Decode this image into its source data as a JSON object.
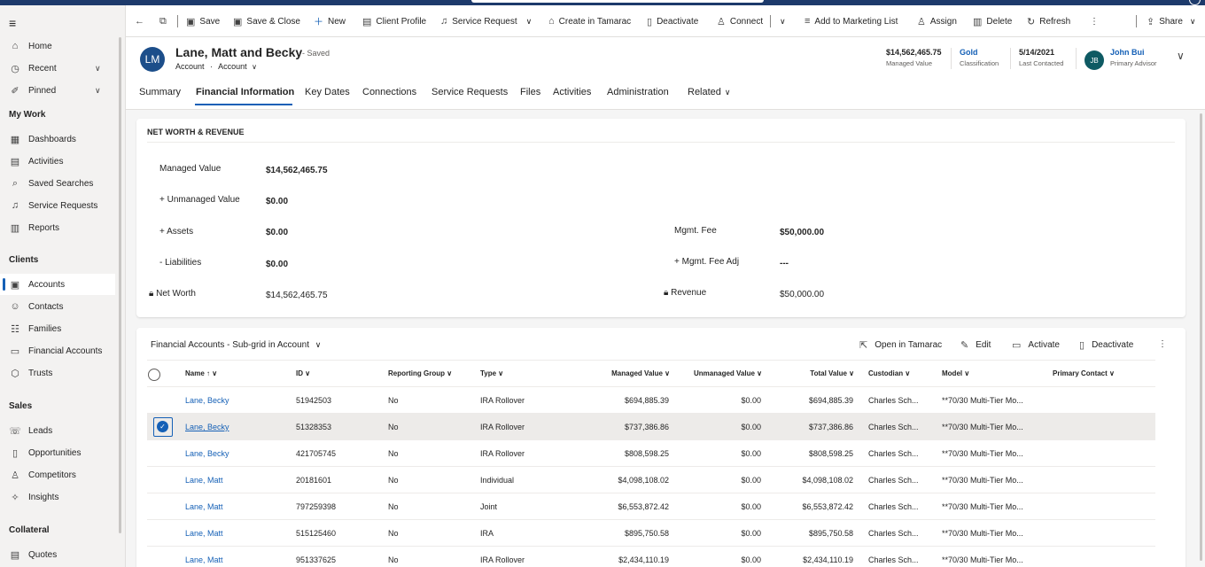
{
  "sidebar": {
    "hamburger": "≡",
    "items": [
      {
        "label": "Home",
        "icon": "⌂"
      },
      {
        "label": "Recent",
        "icon": "◷"
      },
      {
        "label": "Pinned",
        "icon": "✐"
      }
    ],
    "groups": {
      "my_work": "My Work",
      "clients": "Clients",
      "sales": "Sales",
      "collateral": "Collateral"
    },
    "my_work_items": [
      {
        "label": "Dashboards",
        "icon": "▦"
      },
      {
        "label": "Activities",
        "icon": "▤"
      },
      {
        "label": "Saved Searches",
        "icon": "⌕"
      },
      {
        "label": "Service Requests",
        "icon": "♫"
      },
      {
        "label": "Reports",
        "icon": "▥"
      }
    ],
    "client_items": [
      {
        "label": "Accounts",
        "icon": "▣"
      },
      {
        "label": "Contacts",
        "icon": "☺"
      },
      {
        "label": "Families",
        "icon": "☷"
      },
      {
        "label": "Financial Accounts",
        "icon": "▭"
      },
      {
        "label": "Trusts",
        "icon": "⬡"
      }
    ],
    "sales_items": [
      {
        "label": "Leads",
        "icon": "☏"
      },
      {
        "label": "Opportunities",
        "icon": "▯"
      },
      {
        "label": "Competitors",
        "icon": "♙"
      },
      {
        "label": "Insights",
        "icon": "✧"
      }
    ],
    "collateral_items": [
      {
        "label": "Quotes",
        "icon": "▤"
      }
    ]
  },
  "commandbar": {
    "back": "←",
    "popout": "⧉",
    "save": "Save",
    "save_close": "Save & Close",
    "new": "New",
    "client_profile": "Client Profile",
    "service_request": "Service Request",
    "create_tamarac": "Create in Tamarac",
    "deactivate": "Deactivate",
    "connect": "Connect",
    "add_marketing": "Add to Marketing List",
    "assign": "Assign",
    "delete": "Delete",
    "refresh": "Refresh",
    "more": "⋮",
    "share": "Share"
  },
  "header": {
    "avatar_initials": "LM",
    "title": "Lane, Matt and Becky",
    "saved_status": "- Saved",
    "entity": "Account",
    "form": "Account",
    "fields": [
      {
        "value": "$14,562,465.75",
        "label": "Managed Value"
      },
      {
        "value": "Gold",
        "label": "Classification"
      },
      {
        "value": "5/14/2021",
        "label": "Last Contacted"
      },
      {
        "value": "John Bui",
        "label": "Primary Advisor"
      }
    ],
    "advisor_initials": "JB"
  },
  "tabs": [
    "Summary",
    "Financial Information",
    "Key Dates",
    "Connections",
    "Service Requests",
    "Files",
    "Activities",
    "Administration",
    "Related"
  ],
  "networth": {
    "title": "NET WORTH & REVENUE",
    "managed_label": "Managed Value",
    "managed_value": "$14,562,465.75",
    "unmanaged_label": "+ Unmanaged Value",
    "unmanaged_value": "$0.00",
    "assets_label": "+ Assets",
    "assets_value": "$0.00",
    "liabilities_label": "- Liabilities",
    "liabilities_value": "$0.00",
    "networth_label": "Net Worth",
    "networth_value": "$14,562,465.75",
    "fee_label": "Mgmt. Fee",
    "fee_value": "$50,000.00",
    "fee_adj_label": "+ Mgmt. Fee Adj",
    "fee_adj_value": "---",
    "revenue_label": "Revenue",
    "revenue_value": "$50,000.00"
  },
  "subgrid": {
    "title": "Financial Accounts - Sub-grid in Account",
    "commands": {
      "open_tamarac": "Open in Tamarac",
      "edit": "Edit",
      "activate": "Activate",
      "deactivate": "Deactivate",
      "more": "⋮"
    },
    "columns": [
      "Name",
      "ID",
      "Reporting Group",
      "Type",
      "Managed Value",
      "Unmanaged Value",
      "Total Value",
      "Custodian",
      "Model",
      "Primary Contact"
    ],
    "rows": [
      {
        "name": "Lane, Becky",
        "id": "51942503",
        "rg": "No",
        "type": "IRA Rollover",
        "managed": "$694,885.39",
        "unmanaged": "$0.00",
        "total": "$694,885.39",
        "custodian": "Charles Sch...",
        "model": "**70/30 Multi-Tier Mo...",
        "contact": ""
      },
      {
        "name": "Lane, Becky",
        "id": "51328353",
        "rg": "No",
        "type": "IRA Rollover",
        "managed": "$737,386.86",
        "unmanaged": "$0.00",
        "total": "$737,386.86",
        "custodian": "Charles Sch...",
        "model": "**70/30 Multi-Tier Mo...",
        "contact": ""
      },
      {
        "name": "Lane, Becky",
        "id": "421705745",
        "rg": "No",
        "type": "IRA Rollover",
        "managed": "$808,598.25",
        "unmanaged": "$0.00",
        "total": "$808,598.25",
        "custodian": "Charles Sch...",
        "model": "**70/30 Multi-Tier Mo...",
        "contact": ""
      },
      {
        "name": "Lane, Matt",
        "id": "20181601",
        "rg": "No",
        "type": "Individual",
        "managed": "$4,098,108.02",
        "unmanaged": "$0.00",
        "total": "$4,098,108.02",
        "custodian": "Charles Sch...",
        "model": "**70/30 Multi-Tier Mo...",
        "contact": ""
      },
      {
        "name": "Lane, Matt",
        "id": "797259398",
        "rg": "No",
        "type": "Joint",
        "managed": "$6,553,872.42",
        "unmanaged": "$0.00",
        "total": "$6,553,872.42",
        "custodian": "Charles Sch...",
        "model": "**70/30 Multi-Tier Mo...",
        "contact": ""
      },
      {
        "name": "Lane, Matt",
        "id": "515125460",
        "rg": "No",
        "type": "IRA",
        "managed": "$895,750.58",
        "unmanaged": "$0.00",
        "total": "$895,750.58",
        "custodian": "Charles Sch...",
        "model": "**70/30 Multi-Tier Mo...",
        "contact": ""
      },
      {
        "name": "Lane, Matt",
        "id": "951337625",
        "rg": "No",
        "type": "IRA Rollover",
        "managed": "$2,434,110.19",
        "unmanaged": "$0.00",
        "total": "$2,434,110.19",
        "custodian": "Charles Sch...",
        "model": "**70/30 Multi-Tier Mo...",
        "contact": ""
      }
    ]
  },
  "colors": {
    "accent": "#1560b6",
    "topbar": "#1d3a6b",
    "avatar_lm": "#1c4e8a",
    "avatar_jb": "#0e5a63"
  }
}
